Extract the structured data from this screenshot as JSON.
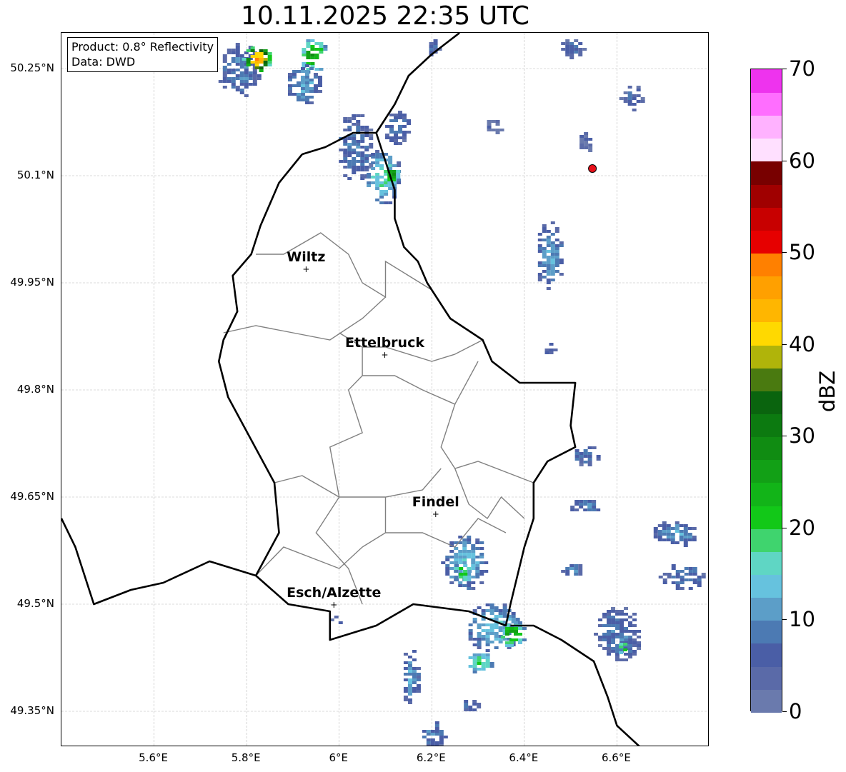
{
  "title": "10.11.2025 22:35 UTC",
  "info_box": {
    "product": "Product: 0.8° Reflectivity",
    "source": "Data: DWD"
  },
  "map_extent": {
    "lon_min": 5.4,
    "lon_max": 6.8,
    "lat_min": 49.3,
    "lat_max": 50.3
  },
  "lat_ticks": [
    {
      "value": 50.25,
      "label": "50.25°N"
    },
    {
      "value": 50.1,
      "label": "50.1°N"
    },
    {
      "value": 49.95,
      "label": "49.95°N"
    },
    {
      "value": 49.8,
      "label": "49.8°N"
    },
    {
      "value": 49.65,
      "label": "49.65°N"
    },
    {
      "value": 49.5,
      "label": "49.5°N"
    },
    {
      "value": 49.35,
      "label": "49.35°N"
    }
  ],
  "lon_ticks": [
    {
      "value": 5.6,
      "label": "5.6°E"
    },
    {
      "value": 5.8,
      "label": "5.8°E"
    },
    {
      "value": 6.0,
      "label": "6°E"
    },
    {
      "value": 6.2,
      "label": "6.2°E"
    },
    {
      "value": 6.4,
      "label": "6.4°E"
    },
    {
      "value": 6.6,
      "label": "6.6°E"
    }
  ],
  "cities": [
    {
      "name": "Wiltz",
      "lon": 5.93,
      "lat": 49.968
    },
    {
      "name": "Ettelbruck",
      "lon": 6.1,
      "lat": 49.848
    },
    {
      "name": "Findel",
      "lon": 6.21,
      "lat": 49.625
    },
    {
      "name": "Esch/Alzette",
      "lon": 5.99,
      "lat": 49.498
    }
  ],
  "radar_site": {
    "lon": 6.547,
    "lat": 50.11,
    "color": "#e8101a"
  },
  "colorbar": {
    "label": "dBZ",
    "min": 0,
    "max": 70,
    "tick_labels": [
      "0",
      "10",
      "20",
      "30",
      "40",
      "50",
      "60",
      "70"
    ],
    "colors": [
      "#6a7aad",
      "#5a6aa8",
      "#4a5ea6",
      "#4c7ab3",
      "#5c9ec8",
      "#66c2de",
      "#5fd6c4",
      "#3fd46e",
      "#12c818",
      "#12b418",
      "#12a016",
      "#108c12",
      "#0c7a10",
      "#0a640e",
      "#4a7a10",
      "#b0b40a",
      "#ffd900",
      "#ffb600",
      "#ffa000",
      "#ff8000",
      "#e60000",
      "#c80000",
      "#a00000",
      "#780000",
      "#ffe0ff",
      "#ffb2ff",
      "#ff6eff",
      "#ee33ee"
    ]
  },
  "echo_cells": [
    {
      "lon": 5.78,
      "lat": 50.25,
      "rx": 0.05,
      "ry": 0.04,
      "level": 3
    },
    {
      "lon": 5.82,
      "lat": 50.265,
      "rx": 0.03,
      "ry": 0.02,
      "level": 18
    },
    {
      "lon": 5.94,
      "lat": 50.27,
      "rx": 0.03,
      "ry": 0.025,
      "level": 10
    },
    {
      "lon": 5.92,
      "lat": 50.23,
      "rx": 0.04,
      "ry": 0.03,
      "level": 4
    },
    {
      "lon": 6.03,
      "lat": 50.14,
      "rx": 0.04,
      "ry": 0.05,
      "level": 3
    },
    {
      "lon": 6.09,
      "lat": 50.1,
      "rx": 0.04,
      "ry": 0.04,
      "level": 6
    },
    {
      "lon": 6.11,
      "lat": 50.105,
      "rx": 0.015,
      "ry": 0.015,
      "level": 11
    },
    {
      "lon": 6.12,
      "lat": 50.17,
      "rx": 0.03,
      "ry": 0.025,
      "level": 3
    },
    {
      "lon": 6.2,
      "lat": 50.28,
      "rx": 0.015,
      "ry": 0.015,
      "level": 2
    },
    {
      "lon": 6.5,
      "lat": 50.28,
      "rx": 0.03,
      "ry": 0.015,
      "level": 2
    },
    {
      "lon": 6.63,
      "lat": 50.21,
      "rx": 0.025,
      "ry": 0.02,
      "level": 2
    },
    {
      "lon": 6.33,
      "lat": 50.17,
      "rx": 0.02,
      "ry": 0.012,
      "level": 1
    },
    {
      "lon": 6.53,
      "lat": 50.15,
      "rx": 0.02,
      "ry": 0.015,
      "level": 1
    },
    {
      "lon": 6.45,
      "lat": 49.99,
      "rx": 0.03,
      "ry": 0.05,
      "level": 4
    },
    {
      "lon": 6.27,
      "lat": 49.56,
      "rx": 0.05,
      "ry": 0.04,
      "level": 5
    },
    {
      "lon": 6.26,
      "lat": 49.545,
      "rx": 0.02,
      "ry": 0.015,
      "level": 8
    },
    {
      "lon": 6.33,
      "lat": 49.47,
      "rx": 0.06,
      "ry": 0.035,
      "level": 5
    },
    {
      "lon": 6.37,
      "lat": 49.46,
      "rx": 0.03,
      "ry": 0.02,
      "level": 10
    },
    {
      "lon": 6.3,
      "lat": 49.42,
      "rx": 0.03,
      "ry": 0.015,
      "level": 7
    },
    {
      "lon": 6.6,
      "lat": 49.46,
      "rx": 0.05,
      "ry": 0.04,
      "level": 3
    },
    {
      "lon": 6.61,
      "lat": 49.44,
      "rx": 0.015,
      "ry": 0.01,
      "level": 9
    },
    {
      "lon": 6.53,
      "lat": 49.71,
      "rx": 0.03,
      "ry": 0.015,
      "level": 3
    },
    {
      "lon": 6.53,
      "lat": 49.64,
      "rx": 0.04,
      "ry": 0.01,
      "level": 3
    },
    {
      "lon": 6.72,
      "lat": 49.6,
      "rx": 0.05,
      "ry": 0.02,
      "level": 4
    },
    {
      "lon": 6.74,
      "lat": 49.54,
      "rx": 0.05,
      "ry": 0.02,
      "level": 3
    },
    {
      "lon": 6.5,
      "lat": 49.55,
      "rx": 0.03,
      "ry": 0.01,
      "level": 3
    },
    {
      "lon": 6.15,
      "lat": 49.4,
      "rx": 0.02,
      "ry": 0.04,
      "level": 4
    },
    {
      "lon": 6.2,
      "lat": 49.32,
      "rx": 0.03,
      "ry": 0.02,
      "level": 3
    },
    {
      "lon": 6.28,
      "lat": 49.36,
      "rx": 0.02,
      "ry": 0.01,
      "level": 3
    },
    {
      "lon": 6.0,
      "lat": 49.48,
      "rx": 0.02,
      "ry": 0.008,
      "level": 3
    },
    {
      "lon": 6.45,
      "lat": 49.86,
      "rx": 0.015,
      "ry": 0.01,
      "level": 2
    }
  ],
  "borders": {
    "luxembourg": [
      [
        5.92,
        50.13
      ],
      [
        5.97,
        50.14
      ],
      [
        6.03,
        50.16
      ],
      [
        6.08,
        50.16
      ],
      [
        6.1,
        50.12
      ],
      [
        6.12,
        50.08
      ],
      [
        6.12,
        50.04
      ],
      [
        6.14,
        50.0
      ],
      [
        6.17,
        49.98
      ],
      [
        6.19,
        49.95
      ],
      [
        6.22,
        49.92
      ],
      [
        6.24,
        49.9
      ],
      [
        6.31,
        49.87
      ],
      [
        6.33,
        49.84
      ],
      [
        6.39,
        49.81
      ],
      [
        6.51,
        49.81
      ],
      [
        6.5,
        49.75
      ],
      [
        6.51,
        49.72
      ],
      [
        6.45,
        49.7
      ],
      [
        6.42,
        49.67
      ],
      [
        6.42,
        49.62
      ],
      [
        6.4,
        49.58
      ],
      [
        6.37,
        49.5
      ],
      [
        6.36,
        49.47
      ],
      [
        6.28,
        49.49
      ],
      [
        6.16,
        49.5
      ],
      [
        6.08,
        49.47
      ],
      [
        5.98,
        49.45
      ],
      [
        5.98,
        49.49
      ],
      [
        5.89,
        49.5
      ],
      [
        5.82,
        49.54
      ],
      [
        5.87,
        49.6
      ],
      [
        5.86,
        49.67
      ],
      [
        5.81,
        49.73
      ],
      [
        5.76,
        49.79
      ],
      [
        5.74,
        49.84
      ],
      [
        5.75,
        49.87
      ],
      [
        5.78,
        49.91
      ],
      [
        5.77,
        49.96
      ],
      [
        5.81,
        49.99
      ],
      [
        5.83,
        50.03
      ],
      [
        5.87,
        50.09
      ],
      [
        5.92,
        50.13
      ]
    ],
    "belgium_germany": [
      [
        6.08,
        50.16
      ],
      [
        6.12,
        50.2
      ],
      [
        6.15,
        50.24
      ],
      [
        6.2,
        50.27
      ],
      [
        6.26,
        50.3
      ]
    ],
    "france_belgium": [
      [
        5.4,
        49.62
      ],
      [
        5.43,
        49.58
      ],
      [
        5.47,
        49.5
      ],
      [
        5.55,
        49.52
      ],
      [
        5.62,
        49.53
      ],
      [
        5.72,
        49.56
      ],
      [
        5.82,
        49.54
      ]
    ],
    "france_germany": [
      [
        6.37,
        49.47
      ],
      [
        6.42,
        49.47
      ],
      [
        6.48,
        49.45
      ],
      [
        6.55,
        49.42
      ],
      [
        6.58,
        49.37
      ],
      [
        6.6,
        49.33
      ],
      [
        6.65,
        49.3
      ]
    ]
  },
  "cantons": [
    [
      [
        5.82,
        49.99
      ],
      [
        5.88,
        49.99
      ],
      [
        5.96,
        50.02
      ],
      [
        6.02,
        49.99
      ],
      [
        6.05,
        49.95
      ],
      [
        6.1,
        49.93
      ],
      [
        6.1,
        49.98
      ],
      [
        6.15,
        49.96
      ],
      [
        6.2,
        49.94
      ]
    ],
    [
      [
        5.75,
        49.88
      ],
      [
        5.82,
        49.89
      ],
      [
        5.9,
        49.88
      ],
      [
        5.98,
        49.87
      ],
      [
        6.05,
        49.9
      ],
      [
        6.1,
        49.93
      ]
    ],
    [
      [
        6.0,
        49.88
      ],
      [
        6.05,
        49.86
      ],
      [
        6.1,
        49.86
      ],
      [
        6.2,
        49.84
      ],
      [
        6.25,
        49.85
      ],
      [
        6.31,
        49.87
      ]
    ],
    [
      [
        6.05,
        49.86
      ],
      [
        6.05,
        49.82
      ],
      [
        6.02,
        49.8
      ],
      [
        6.05,
        49.74
      ],
      [
        5.98,
        49.72
      ],
      [
        6.0,
        49.65
      ],
      [
        5.95,
        49.6
      ],
      [
        6.02,
        49.55
      ],
      [
        6.05,
        49.5
      ]
    ],
    [
      [
        6.05,
        49.82
      ],
      [
        6.12,
        49.82
      ],
      [
        6.18,
        49.8
      ],
      [
        6.25,
        49.78
      ],
      [
        6.3,
        49.84
      ]
    ],
    [
      [
        6.25,
        49.78
      ],
      [
        6.22,
        49.72
      ],
      [
        6.25,
        49.69
      ],
      [
        6.3,
        49.7
      ],
      [
        6.42,
        49.67
      ]
    ],
    [
      [
        5.86,
        49.67
      ],
      [
        5.92,
        49.68
      ],
      [
        6.0,
        49.65
      ],
      [
        6.1,
        49.65
      ],
      [
        6.18,
        49.66
      ],
      [
        6.22,
        49.69
      ]
    ],
    [
      [
        6.1,
        49.65
      ],
      [
        6.1,
        49.6
      ],
      [
        6.05,
        49.58
      ],
      [
        6.0,
        49.55
      ],
      [
        5.88,
        49.58
      ],
      [
        5.82,
        49.54
      ]
    ],
    [
      [
        6.1,
        49.6
      ],
      [
        6.18,
        49.6
      ],
      [
        6.25,
        49.58
      ],
      [
        6.3,
        49.62
      ],
      [
        6.36,
        49.6
      ]
    ],
    [
      [
        6.25,
        49.69
      ],
      [
        6.28,
        49.64
      ],
      [
        6.32,
        49.62
      ],
      [
        6.35,
        49.65
      ],
      [
        6.4,
        49.62
      ]
    ]
  ]
}
